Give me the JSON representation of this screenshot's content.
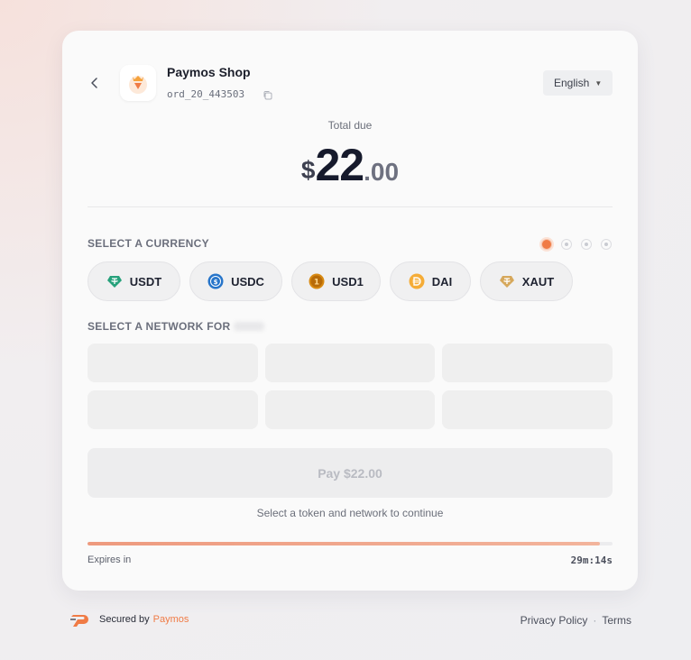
{
  "merchant": {
    "name": "Paymos Shop",
    "order_id": "ord_20_443503"
  },
  "language": {
    "selected": "English"
  },
  "total": {
    "label": "Total due",
    "currency_symbol": "$",
    "integer": "22",
    "decimal": ".00"
  },
  "currency_section": {
    "label": "SELECT A CURRENCY",
    "steps_total": 4,
    "step_active": 1,
    "options": [
      {
        "label": "USDT",
        "icon": "tether-icon",
        "color": "#26a17b"
      },
      {
        "label": "USDC",
        "icon": "usdc-icon",
        "color": "#2775ca"
      },
      {
        "label": "USD1",
        "icon": "usd1-icon",
        "color": "#d88a12"
      },
      {
        "label": "DAI",
        "icon": "dai-icon",
        "color": "#f5ac37"
      },
      {
        "label": "XAUT",
        "icon": "tether-gold-icon",
        "color": "#d6a85c"
      }
    ]
  },
  "network_section": {
    "label": "SELECT A NETWORK FOR"
  },
  "pay_button": {
    "label": "Pay $22.00"
  },
  "hint": "Select a token and network to continue",
  "expiry": {
    "label": "Expires in",
    "timer": "29m:14s",
    "remaining_fraction": 0.976
  },
  "footer": {
    "secured_by": "Secured by",
    "brand": "Paymos",
    "privacy": "Privacy Policy",
    "separator": "·",
    "terms": "Terms"
  },
  "colors": {
    "accent": "#f07b45"
  }
}
